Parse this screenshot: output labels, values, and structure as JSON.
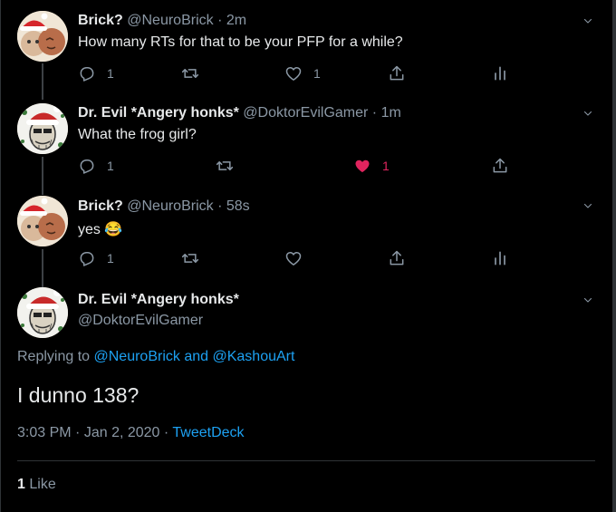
{
  "tweets": [
    {
      "name": "Brick?",
      "handle": "@NeuroBrick",
      "separator": "·",
      "time": "2m",
      "text": "How many RTs for that to be your PFP for a while?",
      "reply_count": "1",
      "retweet_count": "",
      "like_count": "1",
      "liked": false
    },
    {
      "name": "Dr. Evil *Angery honks*",
      "handle": "@DoktorEvilGamer",
      "separator": "·",
      "time": "1m",
      "text": "What the frog girl?",
      "reply_count": "1",
      "retweet_count": "",
      "like_count": "1",
      "liked": true
    },
    {
      "name": "Brick?",
      "handle": "@NeuroBrick",
      "separator": "·",
      "time": "58s",
      "text": "yes 😂",
      "reply_count": "1",
      "retweet_count": "",
      "like_count": "",
      "liked": false
    }
  ],
  "main_tweet": {
    "name": "Dr. Evil *Angery honks*",
    "handle": "@DoktorEvilGamer",
    "replying_prefix": "Replying to",
    "replying_user1": "@NeuroBrick",
    "replying_and": "and",
    "replying_user2": "@KashouArt",
    "text": "I dunno 138?",
    "time": "3:03 PM",
    "separator": "·",
    "date": "Jan 2, 2020",
    "source": "TweetDeck",
    "like_count": "1",
    "like_label": "Like"
  },
  "colors": {
    "background": "#000000",
    "accent_link": "#1da1f2",
    "like_active": "#e0245e",
    "secondary_text": "#8b98a5"
  },
  "icons": [
    "avatar-brick",
    "avatar-dr-evil",
    "chevron-down-icon",
    "reply-icon",
    "retweet-icon",
    "heart-icon",
    "share-icon",
    "analytics-icon"
  ]
}
